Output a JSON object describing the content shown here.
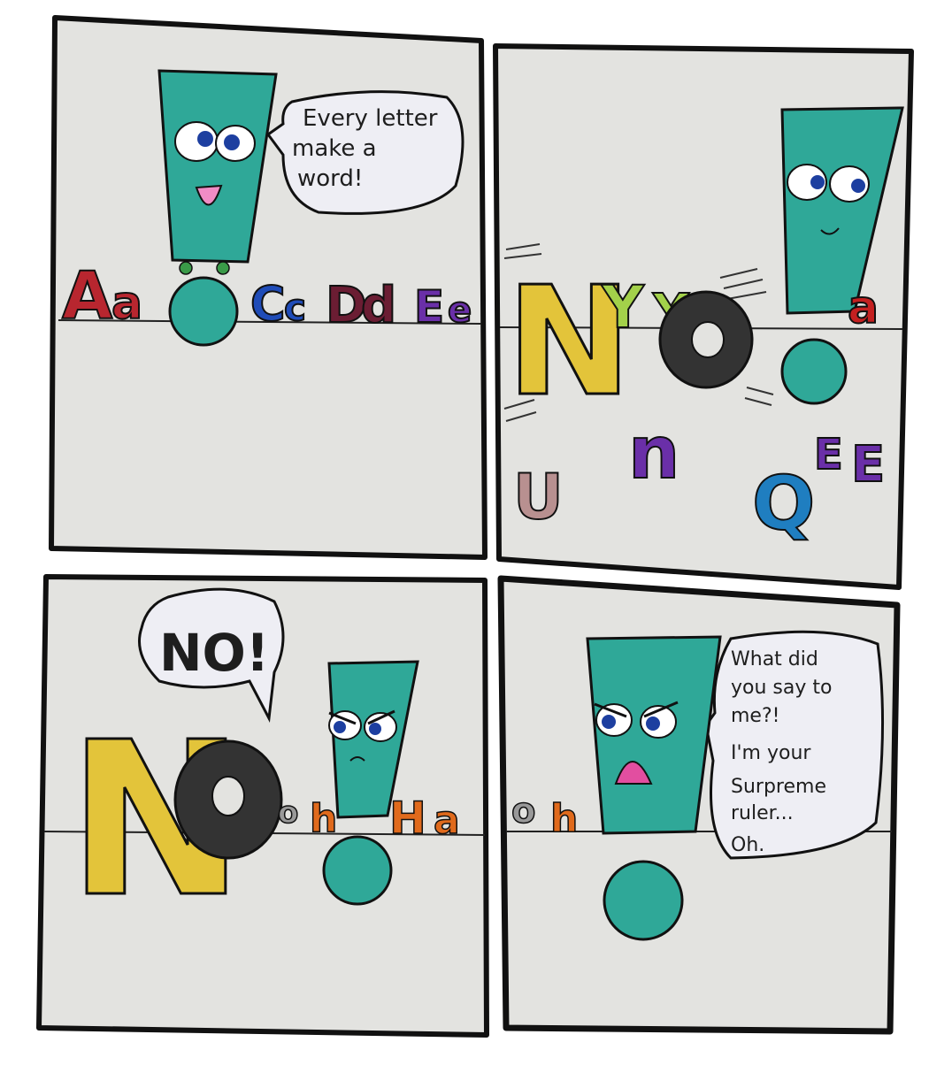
{
  "panels": [
    {
      "speech": [
        "Every letter",
        "make a",
        "word!"
      ],
      "row_letters": [
        "A",
        "a",
        "C",
        "c",
        "D",
        "d",
        "E",
        "e"
      ]
    },
    {
      "row_letters": [
        "N",
        "Y",
        "Y",
        "o",
        "a"
      ],
      "scattered_letters": [
        "U",
        "n",
        "Q",
        "E",
        "E"
      ]
    },
    {
      "speech": [
        "NO!"
      ],
      "row_letters": [
        "N",
        "o",
        "o",
        "h",
        "H",
        "a"
      ]
    },
    {
      "speech": [
        "What did",
        "you say to",
        "me?!",
        "I'm your",
        "Surpreme",
        "ruler...",
        "Oh."
      ],
      "row_letters": [
        "o",
        "h"
      ]
    }
  ],
  "colors": {
    "paper": "#e3e3e0",
    "teal": "#2fa898",
    "bubble": "#eeeef4",
    "outline": "#111111"
  }
}
